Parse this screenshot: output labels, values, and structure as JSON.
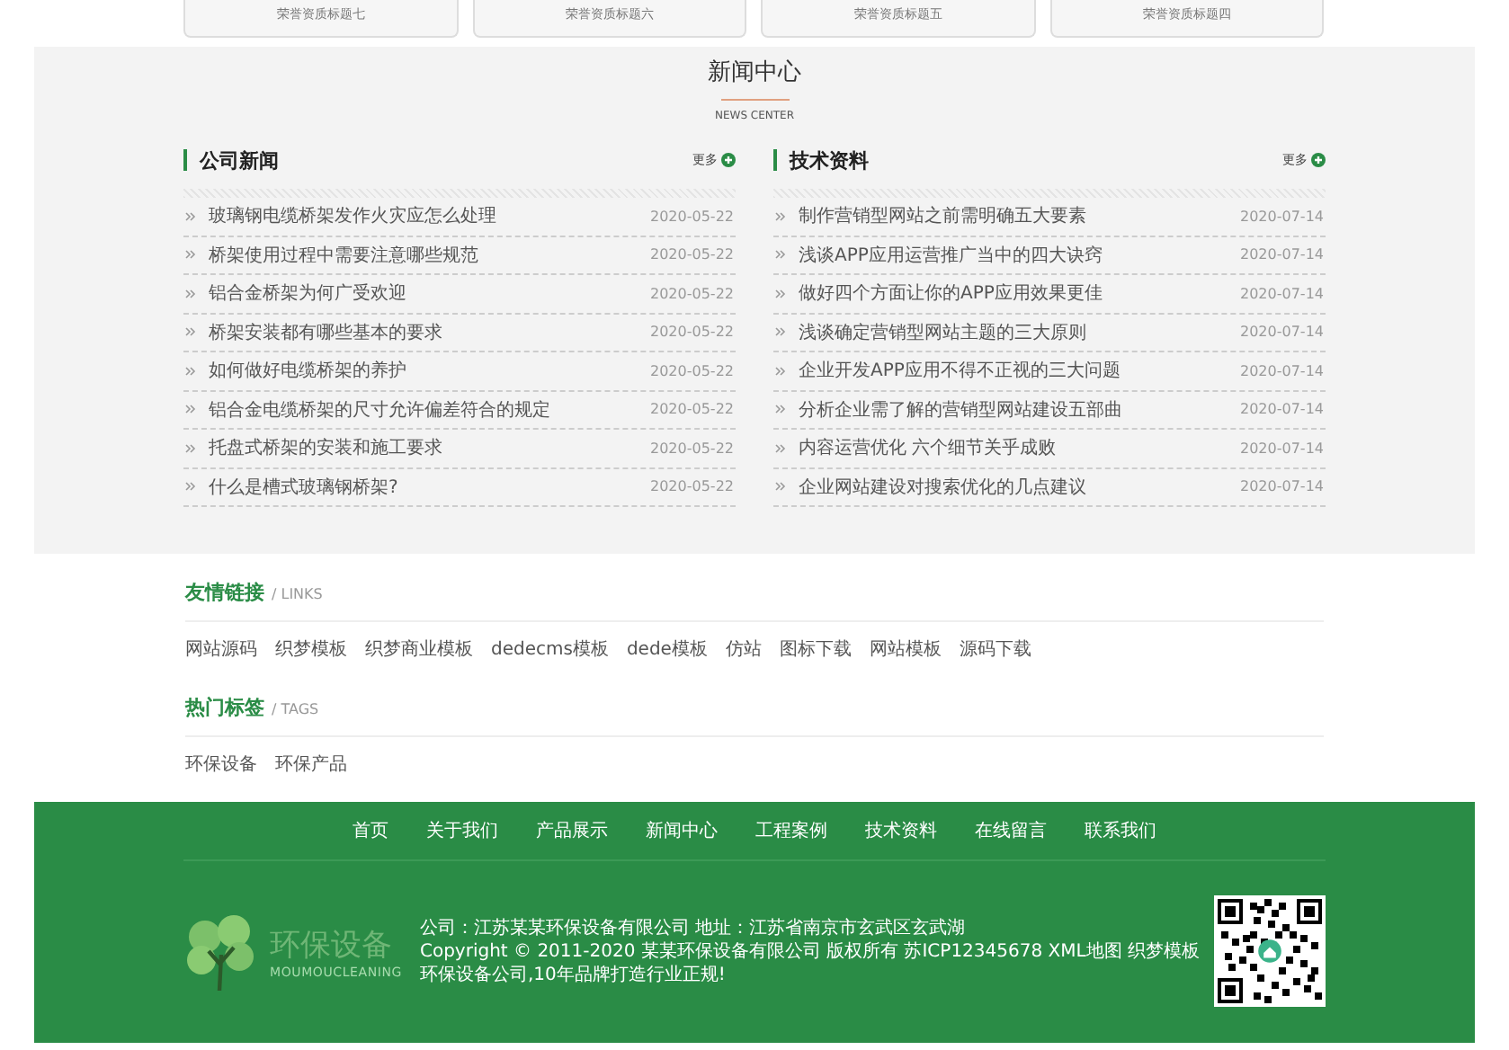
{
  "certificates": [
    "荣誉资质标题七",
    "荣誉资质标题六",
    "荣誉资质标题五",
    "荣誉资质标题四"
  ],
  "news_center": {
    "title": "新闻中心",
    "subtitle": "NEWS CENTER",
    "columns": [
      {
        "heading": "公司新闻",
        "more": "更多",
        "items": [
          {
            "title": "玻璃钢电缆桥架发作火灾应怎么处理",
            "date": "2020-05-22"
          },
          {
            "title": "桥架使用过程中需要注意哪些规范",
            "date": "2020-05-22"
          },
          {
            "title": "铝合金桥架为何广受欢迎",
            "date": "2020-05-22"
          },
          {
            "title": "桥架安装都有哪些基本的要求",
            "date": "2020-05-22"
          },
          {
            "title": "如何做好电缆桥架的养护",
            "date": "2020-05-22"
          },
          {
            "title": "铝合金电缆桥架的尺寸允许偏差符合的规定",
            "date": "2020-05-22"
          },
          {
            "title": "托盘式桥架的安装和施工要求",
            "date": "2020-05-22"
          },
          {
            "title": "什么是槽式玻璃钢桥架?",
            "date": "2020-05-22"
          }
        ]
      },
      {
        "heading": "技术资料",
        "more": "更多",
        "items": [
          {
            "title": "制作营销型网站之前需明确五大要素",
            "date": "2020-07-14"
          },
          {
            "title": "浅谈APP应用运营推广当中的四大诀窍",
            "date": "2020-07-14"
          },
          {
            "title": "做好四个方面让你的APP应用效果更佳",
            "date": "2020-07-14"
          },
          {
            "title": "浅谈确定营销型网站主题的三大原则",
            "date": "2020-07-14"
          },
          {
            "title": "企业开发APP应用不得不正视的三大问题",
            "date": "2020-07-14"
          },
          {
            "title": "分析企业需了解的营销型网站建设五部曲",
            "date": "2020-07-14"
          },
          {
            "title": "内容运营优化 六个细节关乎成败",
            "date": "2020-07-14"
          },
          {
            "title": "企业网站建设对搜索优化的几点建议",
            "date": "2020-07-14"
          }
        ]
      }
    ]
  },
  "links": {
    "heading": "友情链接",
    "sub": "/ LINKS",
    "items": [
      "网站源码",
      "织梦模板",
      "织梦商业模板",
      "dedecms模板",
      "dede模板",
      "仿站",
      "图标下载",
      "网站模板",
      "源码下载"
    ]
  },
  "tags": {
    "heading": "热门标签",
    "sub": "/ TAGS",
    "items": [
      "环保设备",
      "环保产品"
    ]
  },
  "footer": {
    "nav": [
      "首页",
      "关于我们",
      "产品展示",
      "新闻中心",
      "工程案例",
      "技术资料",
      "在线留言",
      "联系我们"
    ],
    "logo": {
      "name": "环保设备",
      "sub": "MOUMOUCLEANING"
    },
    "info": [
      "公司：江苏某某环保设备有限公司 地址：江苏省南京市玄武区玄武湖",
      "Copyright © 2011-2020 某某环保设备有限公司 版权所有 苏ICP12345678 XML地图 织梦模板",
      "环保设备公司,10年品牌打造行业正规!"
    ]
  }
}
